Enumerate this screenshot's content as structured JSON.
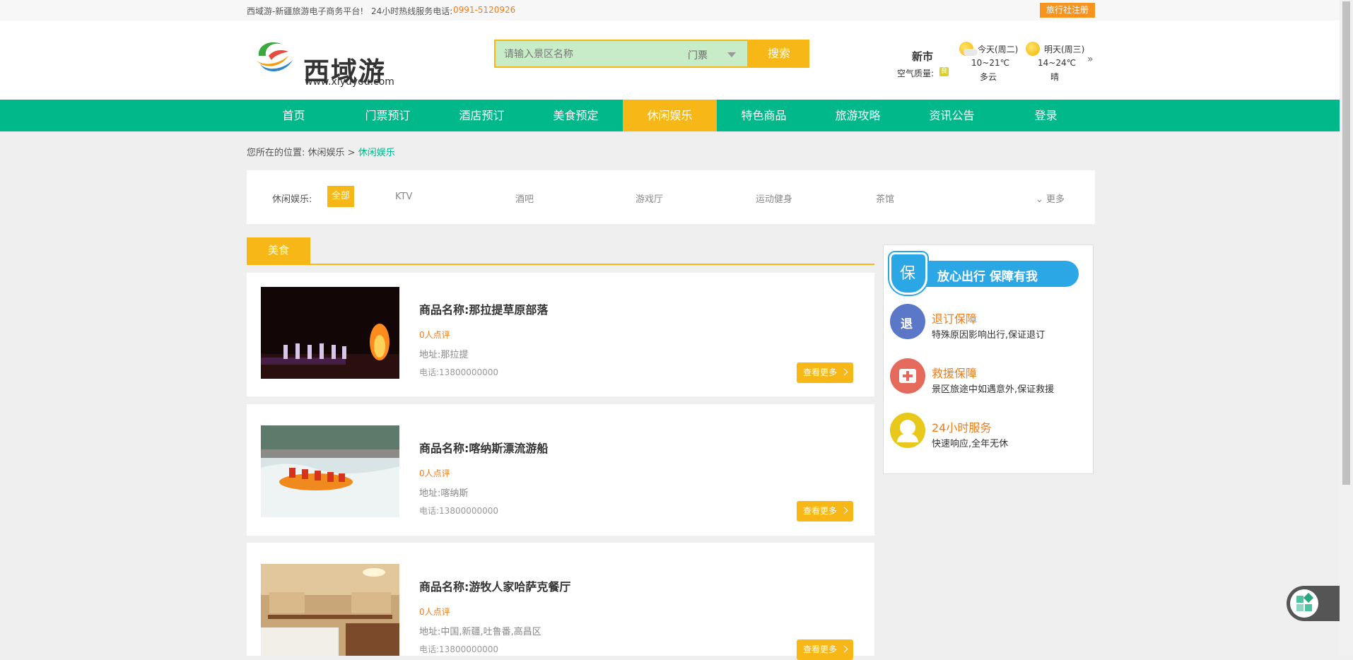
{
  "topbar": {
    "site_text": "西域游-新疆旅游电子商务平台!",
    "hotline_label": "24小时热线服务电话:",
    "hotline_number": "0991-5120926",
    "agency_register": "旅行社注册"
  },
  "header": {
    "logo_name": "西域游",
    "logo_url": "www.xiyuyou.com",
    "search_placeholder": "请输入景区名称",
    "search_type": "门票",
    "search_button": "搜索",
    "city": "新市",
    "air_quality_label": "空气质量:",
    "air_quality_value": "良",
    "weather": [
      {
        "day": "今天(周二)",
        "temp": "10~21℃",
        "desc": "多云"
      },
      {
        "day": "明天(周三)",
        "temp": "14~24℃",
        "desc": "晴"
      }
    ],
    "weather_more": "»"
  },
  "nav": {
    "items": [
      {
        "label": "首页"
      },
      {
        "label": "门票预订"
      },
      {
        "label": "酒店预订"
      },
      {
        "label": "美食预定"
      },
      {
        "label": "休闲娱乐",
        "active": true
      },
      {
        "label": "特色商品"
      },
      {
        "label": "旅游攻略"
      },
      {
        "label": "资讯公告"
      },
      {
        "label": "登录"
      }
    ]
  },
  "breadcrumb": {
    "prefix": "您所在的位置:",
    "parent": "休闲娱乐 >",
    "current": "休闲娱乐"
  },
  "filter": {
    "label": "休闲娱乐:",
    "options": [
      "全部",
      "KTV",
      "酒吧",
      "游戏厅",
      "运动健身",
      "茶馆"
    ],
    "active": "全部",
    "more": "更多"
  },
  "section": {
    "title": "美食"
  },
  "items": [
    {
      "name": "商品名称:那拉提草原部落",
      "reviews": "0人点评",
      "address": "地址:那拉提",
      "phone": "电话:13800000000",
      "button": "查看更多"
    },
    {
      "name": "商品名称:喀纳斯漂流游船",
      "reviews": "0人点评",
      "address": "地址:喀纳斯",
      "phone": "电话:13800000000",
      "button": "查看更多"
    },
    {
      "name": "商品名称:游牧人家哈萨克餐厅",
      "reviews": "0人点评",
      "address": "地址:中国,新疆,吐鲁番,高昌区",
      "phone": "电话:13800000000",
      "button": "查看更多"
    }
  ],
  "guarantee": {
    "shield_char": "保",
    "banner": "放心出行  保障有我",
    "rows": [
      {
        "icon_char": "退",
        "title": "退订保障",
        "desc": "特殊原因影响出行,保证退订"
      },
      {
        "title": "救援保障",
        "desc": "景区旅途中如遇意外,保证救援"
      },
      {
        "title": "24小时服务",
        "desc": "快速响应,全年无休"
      }
    ]
  },
  "colors": {
    "brand_green": "#00b88a",
    "accent_orange": "#f7b716",
    "text_orange": "#f07d1a"
  }
}
